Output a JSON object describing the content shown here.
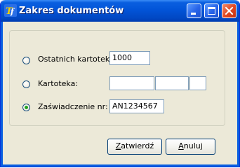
{
  "window": {
    "title": "Zakres dokumentów"
  },
  "options": {
    "ostatnich": {
      "label": "Ostatnich kartotek",
      "value": "1000",
      "selected": false
    },
    "kartoteka": {
      "label": "Kartoteka:",
      "values": [
        "",
        "",
        ""
      ],
      "selected": false
    },
    "zaswiadczenie": {
      "label": "Zaświadczenie nr:",
      "value": "AN1234567",
      "selected": true
    }
  },
  "buttons": {
    "confirm_underline": "Z",
    "confirm_rest": "atwierdź",
    "cancel_underline": "A",
    "cancel_rest": "nuluj"
  },
  "colors": {
    "titlebar": "#0254d8",
    "dialog_bg": "#ece9d8",
    "radio_selected": "#21a121",
    "close_button": "#e0451f"
  }
}
